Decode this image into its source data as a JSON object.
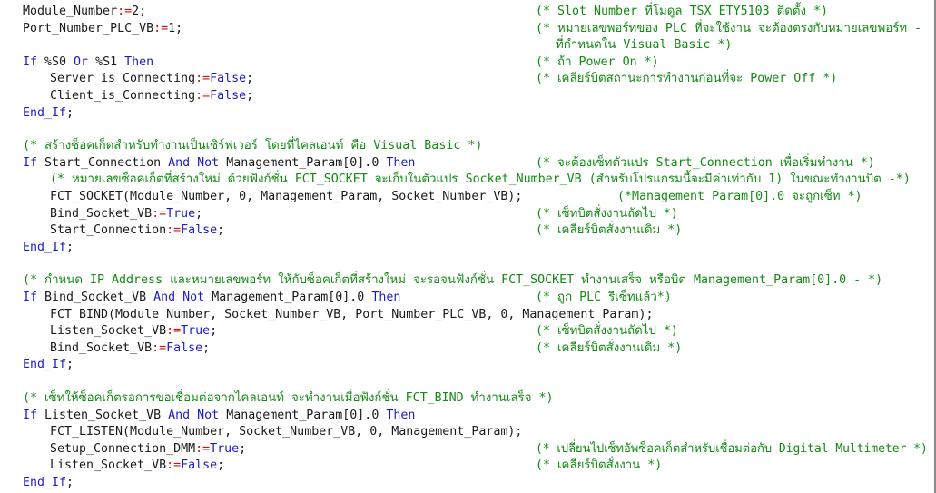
{
  "editor": {
    "lines": [
      {
        "indent": 0,
        "code": [
          [
            "id",
            "Module_Number"
          ],
          [
            "op",
            ":="
          ],
          [
            "num",
            "2"
          ],
          [
            "id",
            ";"
          ]
        ],
        "comment": "(* Slot Number ที่โมดูล TSX ETY5103 ติดตั้ง *)",
        "commentCol": 590
      },
      {
        "indent": 0,
        "code": [
          [
            "id",
            "Port_Number_PLC_VB"
          ],
          [
            "op",
            ":="
          ],
          [
            "num",
            "1"
          ],
          [
            "id",
            ";"
          ]
        ],
        "comment": "(* หมายเลขพอร์ทของ PLC ที่จะใช้งาน จะต้องตรงกับหมายเลขพอร์ท -",
        "commentCol": 590
      },
      {
        "indent": 0,
        "code": [],
        "comment": "ที่กำหนดใน Visual Basic *)",
        "commentCol": 612
      },
      {
        "indent": 0,
        "code": [
          [
            "kw",
            "If"
          ],
          [
            "id",
            " %S0 "
          ],
          [
            "kw",
            "Or"
          ],
          [
            "id",
            " %S1 "
          ],
          [
            "kw",
            "Then"
          ]
        ],
        "comment": "(* ถ้า Power On *)",
        "commentCol": 590
      },
      {
        "indent": 1,
        "code": [
          [
            "id",
            "Server_is_Connecting"
          ],
          [
            "op",
            ":="
          ],
          [
            "kw",
            "False"
          ],
          [
            "id",
            ";"
          ]
        ],
        "comment": "(* เคลียร์บิตสถานะการทำงานก่อนที่จะ Power Off *)",
        "commentCol": 590
      },
      {
        "indent": 1,
        "code": [
          [
            "id",
            "Client_is_Connecting"
          ],
          [
            "op",
            ":="
          ],
          [
            "kw",
            "False"
          ],
          [
            "id",
            ";"
          ]
        ],
        "comment": "",
        "commentCol": 590
      },
      {
        "indent": 0,
        "code": [
          [
            "kw",
            "End_If"
          ],
          [
            "id",
            ";"
          ]
        ],
        "comment": "",
        "commentCol": 590
      },
      {
        "blank": true
      },
      {
        "indent": 0,
        "code": [],
        "comment": "(* สร้างซ็อคเก็ตสำหรับทำงานเป็นเซิร์ฟเวอร์ โดยที่ไคลเอนท์ คือ Visual Basic *)",
        "commentCol": 25
      },
      {
        "indent": 0,
        "code": [
          [
            "kw",
            "If"
          ],
          [
            "id",
            " Start_Connection "
          ],
          [
            "kw",
            "And"
          ],
          [
            "id",
            " "
          ],
          [
            "kw",
            "Not"
          ],
          [
            "id",
            " Management_Param[0].0 "
          ],
          [
            "kw",
            "Then"
          ]
        ],
        "comment": "(* จะต้องเซ็ทตัวแปร Start_Connection เพื่อเริ่มทำงาน *)",
        "commentCol": 590
      },
      {
        "indent": 1,
        "code": [],
        "comment": "(* หมายเลขซ็อคเก็ตที่สร้างใหม่ ด้วยฟังก์ชั่น FCT_SOCKET จะเก็บในตัวแปร Socket_Number_VB (สำหรับโปรแกรมนี้จะมีค่าเท่ากับ 1) ในขณะทำงานบิต -*)",
        "commentCol": 55
      },
      {
        "indent": 1,
        "code": [
          [
            "id",
            "FCT_SOCKET(Module_Number, 0, Management_Param, Socket_Number_VB)"
          ],
          [
            "id",
            ";"
          ]
        ],
        "comment": "(*Management_Param[0].0 จะถูกเซ็ท *)",
        "commentCol": 680
      },
      {
        "indent": 1,
        "code": [
          [
            "id",
            "Bind_Socket_VB"
          ],
          [
            "op",
            ":="
          ],
          [
            "kw",
            "True"
          ],
          [
            "id",
            ";"
          ]
        ],
        "comment": "(* เซ็ทบิตสั่งงานถัดไป *)",
        "commentCol": 590
      },
      {
        "indent": 1,
        "code": [
          [
            "id",
            "Start_Connection"
          ],
          [
            "op",
            ":="
          ],
          [
            "kw",
            "False"
          ],
          [
            "id",
            ";"
          ]
        ],
        "comment": "(* เคลียร์บิตสั่งงานเดิม *)",
        "commentCol": 590
      },
      {
        "indent": 0,
        "code": [
          [
            "kw",
            "End_If"
          ],
          [
            "id",
            ";"
          ]
        ],
        "comment": "",
        "commentCol": 590
      },
      {
        "blank": true
      },
      {
        "indent": 0,
        "code": [],
        "comment": "(* กำหนด IP Address และหมายเลขพอร์ท ให้กับซ็อคเก็ตที่สร้างใหม่ จะรอจนฟังก์ชั่น FCT_SOCKET ทำงานเสร็จ หรือบิต Management_Param[0].0 - *)",
        "commentCol": 25
      },
      {
        "indent": 0,
        "code": [
          [
            "kw",
            "If"
          ],
          [
            "id",
            " Bind_Socket_VB "
          ],
          [
            "kw",
            "And"
          ],
          [
            "id",
            " "
          ],
          [
            "kw",
            "Not"
          ],
          [
            "id",
            " Management_Param[0].0 "
          ],
          [
            "kw",
            "Then"
          ]
        ],
        "comment": "(* ถูก PLC รีเซ็ทแล้ว*)",
        "commentCol": 590
      },
      {
        "indent": 1,
        "code": [
          [
            "id",
            "FCT_BIND(Module_Number, Socket_Number_VB, Port_Number_PLC_VB, 0, Management_Param)"
          ],
          [
            "id",
            ";"
          ]
        ],
        "comment": "",
        "commentCol": 590
      },
      {
        "indent": 1,
        "code": [
          [
            "id",
            "Listen_Socket_VB"
          ],
          [
            "op",
            ":="
          ],
          [
            "kw",
            "True"
          ],
          [
            "id",
            ";"
          ]
        ],
        "comment": "(* เซ็ทบิตสั่งงานถัดไป *)",
        "commentCol": 590
      },
      {
        "indent": 1,
        "code": [
          [
            "id",
            "Bind_Socket_VB"
          ],
          [
            "op",
            ":="
          ],
          [
            "kw",
            "False"
          ],
          [
            "id",
            ";"
          ]
        ],
        "comment": "(* เคลียร์บิตสั่งงานเดิม *)",
        "commentCol": 590
      },
      {
        "indent": 0,
        "code": [
          [
            "kw",
            "End_If"
          ],
          [
            "id",
            ";"
          ]
        ],
        "comment": "",
        "commentCol": 590
      },
      {
        "blank": true
      },
      {
        "indent": 0,
        "code": [],
        "comment": "(* เซ็ทให้ซ็อคเก็ตรอการขอเชื่อมต่อจากไคลเอนท์ จะทำงานเมื่อฟังก์ชั่น FCT_BIND ทำงานเสร็จ *)",
        "commentCol": 25
      },
      {
        "indent": 0,
        "code": [
          [
            "kw",
            "If"
          ],
          [
            "id",
            " Listen_Socket_VB "
          ],
          [
            "kw",
            "And"
          ],
          [
            "id",
            " "
          ],
          [
            "kw",
            "Not"
          ],
          [
            "id",
            " Management_Param[0].0 "
          ],
          [
            "kw",
            "Then"
          ]
        ],
        "comment": "",
        "commentCol": 590
      },
      {
        "indent": 1,
        "code": [
          [
            "id",
            "FCT_LISTEN(Module_Number, Socket_Number_VB, 0, Management_Param)"
          ],
          [
            "id",
            ";"
          ]
        ],
        "comment": "",
        "commentCol": 590
      },
      {
        "indent": 1,
        "code": [
          [
            "id",
            "Setup_Connection_DMM"
          ],
          [
            "op",
            ":="
          ],
          [
            "kw",
            "True"
          ],
          [
            "id",
            ";"
          ]
        ],
        "comment": "(* เปลี่ยนไปเซ็ทอัพซ็อคเก็ตสำหรับเชื่อมต่อกับ Digital Multimeter *)",
        "commentCol": 590
      },
      {
        "indent": 1,
        "code": [
          [
            "id",
            "Listen_Socket_VB"
          ],
          [
            "op",
            ":="
          ],
          [
            "kw",
            "False"
          ],
          [
            "id",
            ";"
          ]
        ],
        "comment": "(* เคลียร์บิตสั่งงาน *)",
        "commentCol": 590
      },
      {
        "indent": 0,
        "code": [
          [
            "kw",
            "End_If"
          ],
          [
            "id",
            ";"
          ]
        ],
        "comment": "",
        "commentCol": 590
      }
    ]
  }
}
